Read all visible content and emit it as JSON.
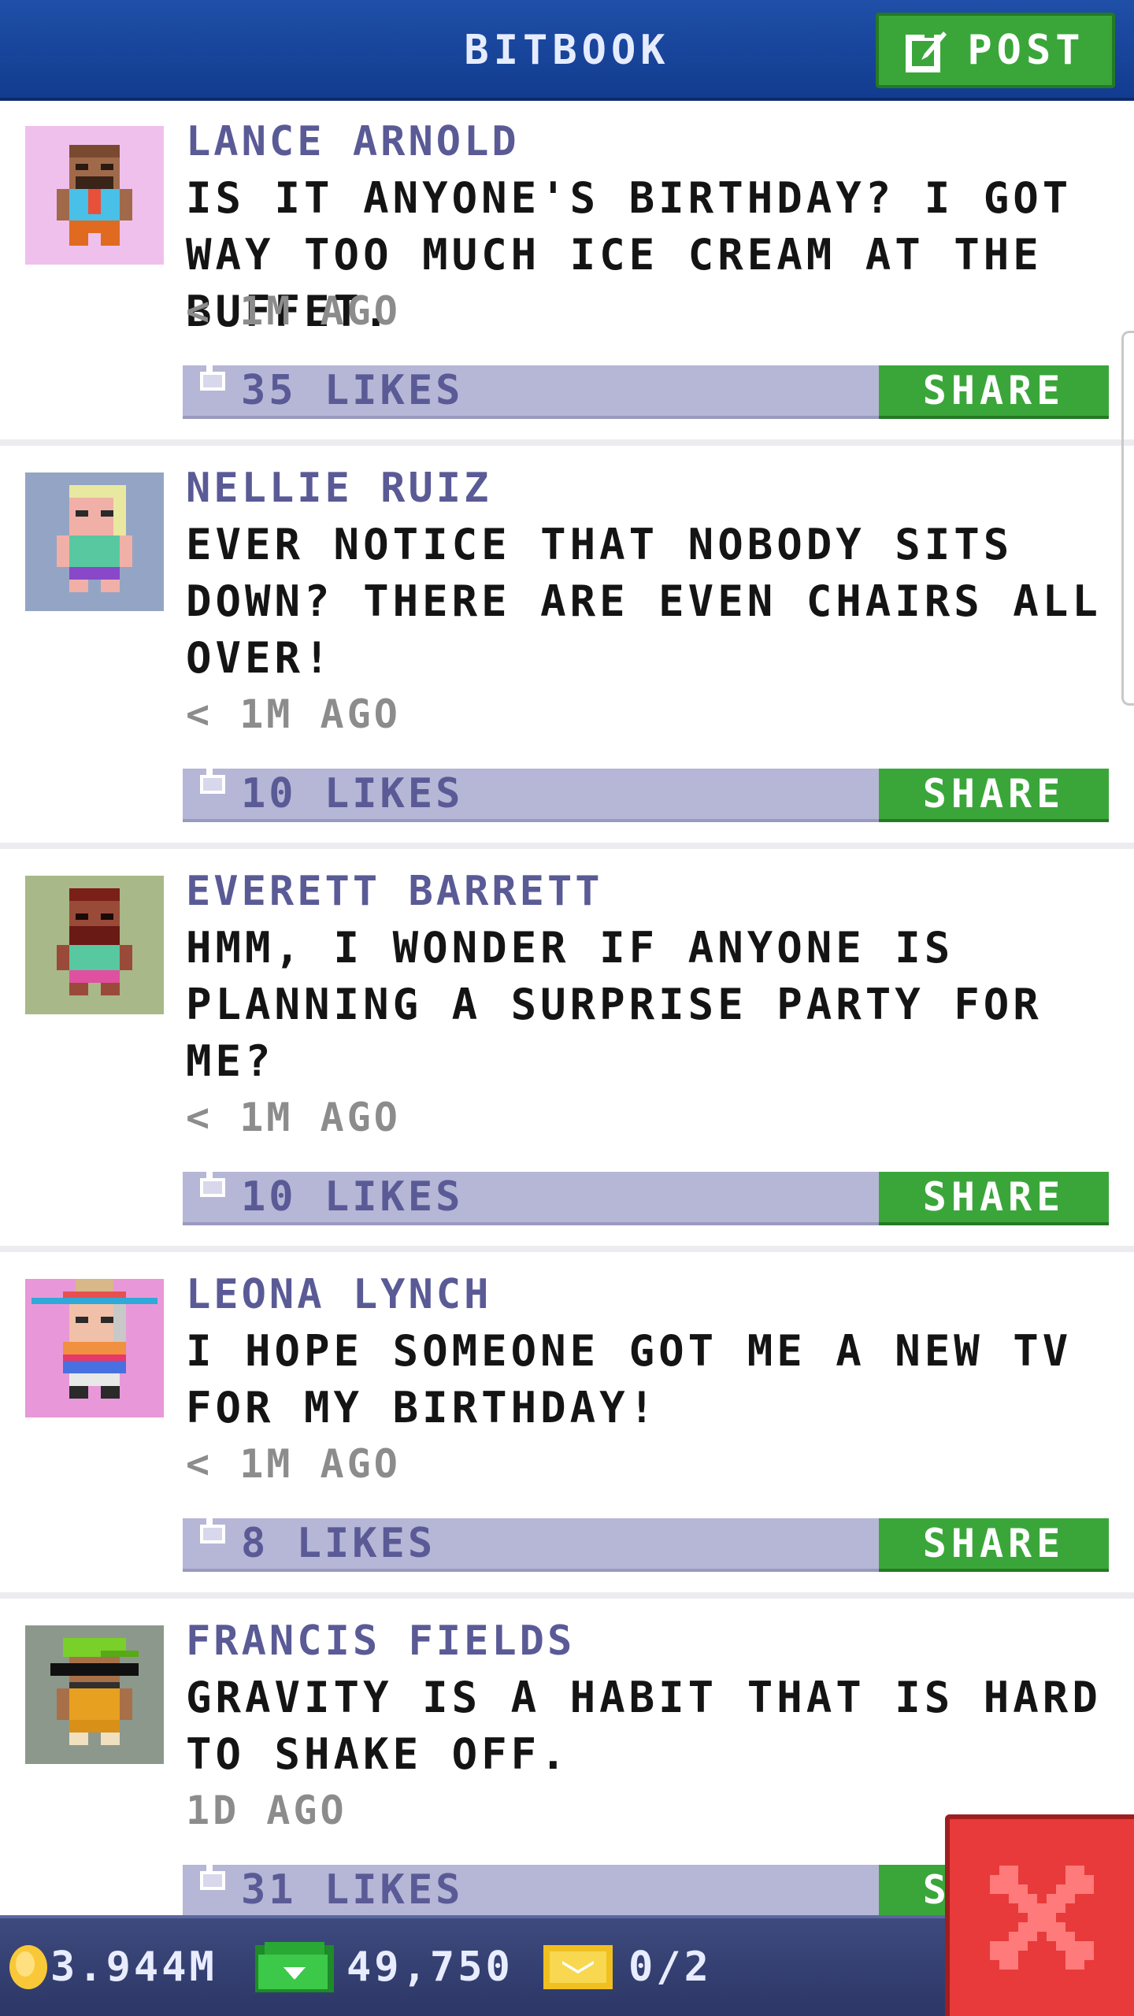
{
  "header": {
    "title": "BITBOOK",
    "post_label": "POST"
  },
  "posts": [
    {
      "name": "LANCE ARNOLD",
      "text": "IS IT ANYONE'S BIRTHDAY? I GOT WAY TOO MUCH ICE CREAM AT THE BUFFET.",
      "time": "< 1M AGO",
      "likes": "35 LIKES",
      "share": "SHARE",
      "avatar_bg": "#f0c0ec"
    },
    {
      "name": "NELLIE RUIZ",
      "text": "EVER NOTICE THAT NOBODY SITS DOWN? THERE ARE EVEN CHAIRS ALL OVER!",
      "time": "< 1M AGO",
      "likes": "10 LIKES",
      "share": "SHARE",
      "avatar_bg": "#94a4c4"
    },
    {
      "name": "EVERETT BARRETT",
      "text": "HMM, I WONDER IF ANYONE IS PLANNING A SURPRISE PARTY FOR ME?",
      "time": "< 1M AGO",
      "likes": "10 LIKES",
      "share": "SHARE",
      "avatar_bg": "#a8b888"
    },
    {
      "name": "LEONA LYNCH",
      "text": "I HOPE SOMEONE GOT ME A NEW TV FOR MY BIRTHDAY!",
      "time": "< 1M AGO",
      "likes": "8 LIKES",
      "share": "SHARE",
      "avatar_bg": "#e898d8"
    },
    {
      "name": "FRANCIS FIELDS",
      "text": "GRAVITY IS A HABIT THAT IS HARD TO SHAKE OFF.",
      "time": "1D AGO",
      "likes": "31 LIKES",
      "share": "SHARE",
      "avatar_bg": "#8c988c"
    }
  ],
  "footer": {
    "coins": "3.944M",
    "bux": "49,750",
    "tickets": "0/2"
  },
  "icons": {
    "post": "edit-icon",
    "like": "thumbs-up-icon",
    "coin": "coin-icon",
    "bux": "bux-icon",
    "ticket": "ticket-icon",
    "close": "close-icon"
  },
  "colors": {
    "header": "#1f4fa8",
    "green_button": "#3aa63a",
    "likes_bar": "#b6b6d6",
    "name_text": "#5a5a96",
    "close_button": "#e83a3a"
  }
}
